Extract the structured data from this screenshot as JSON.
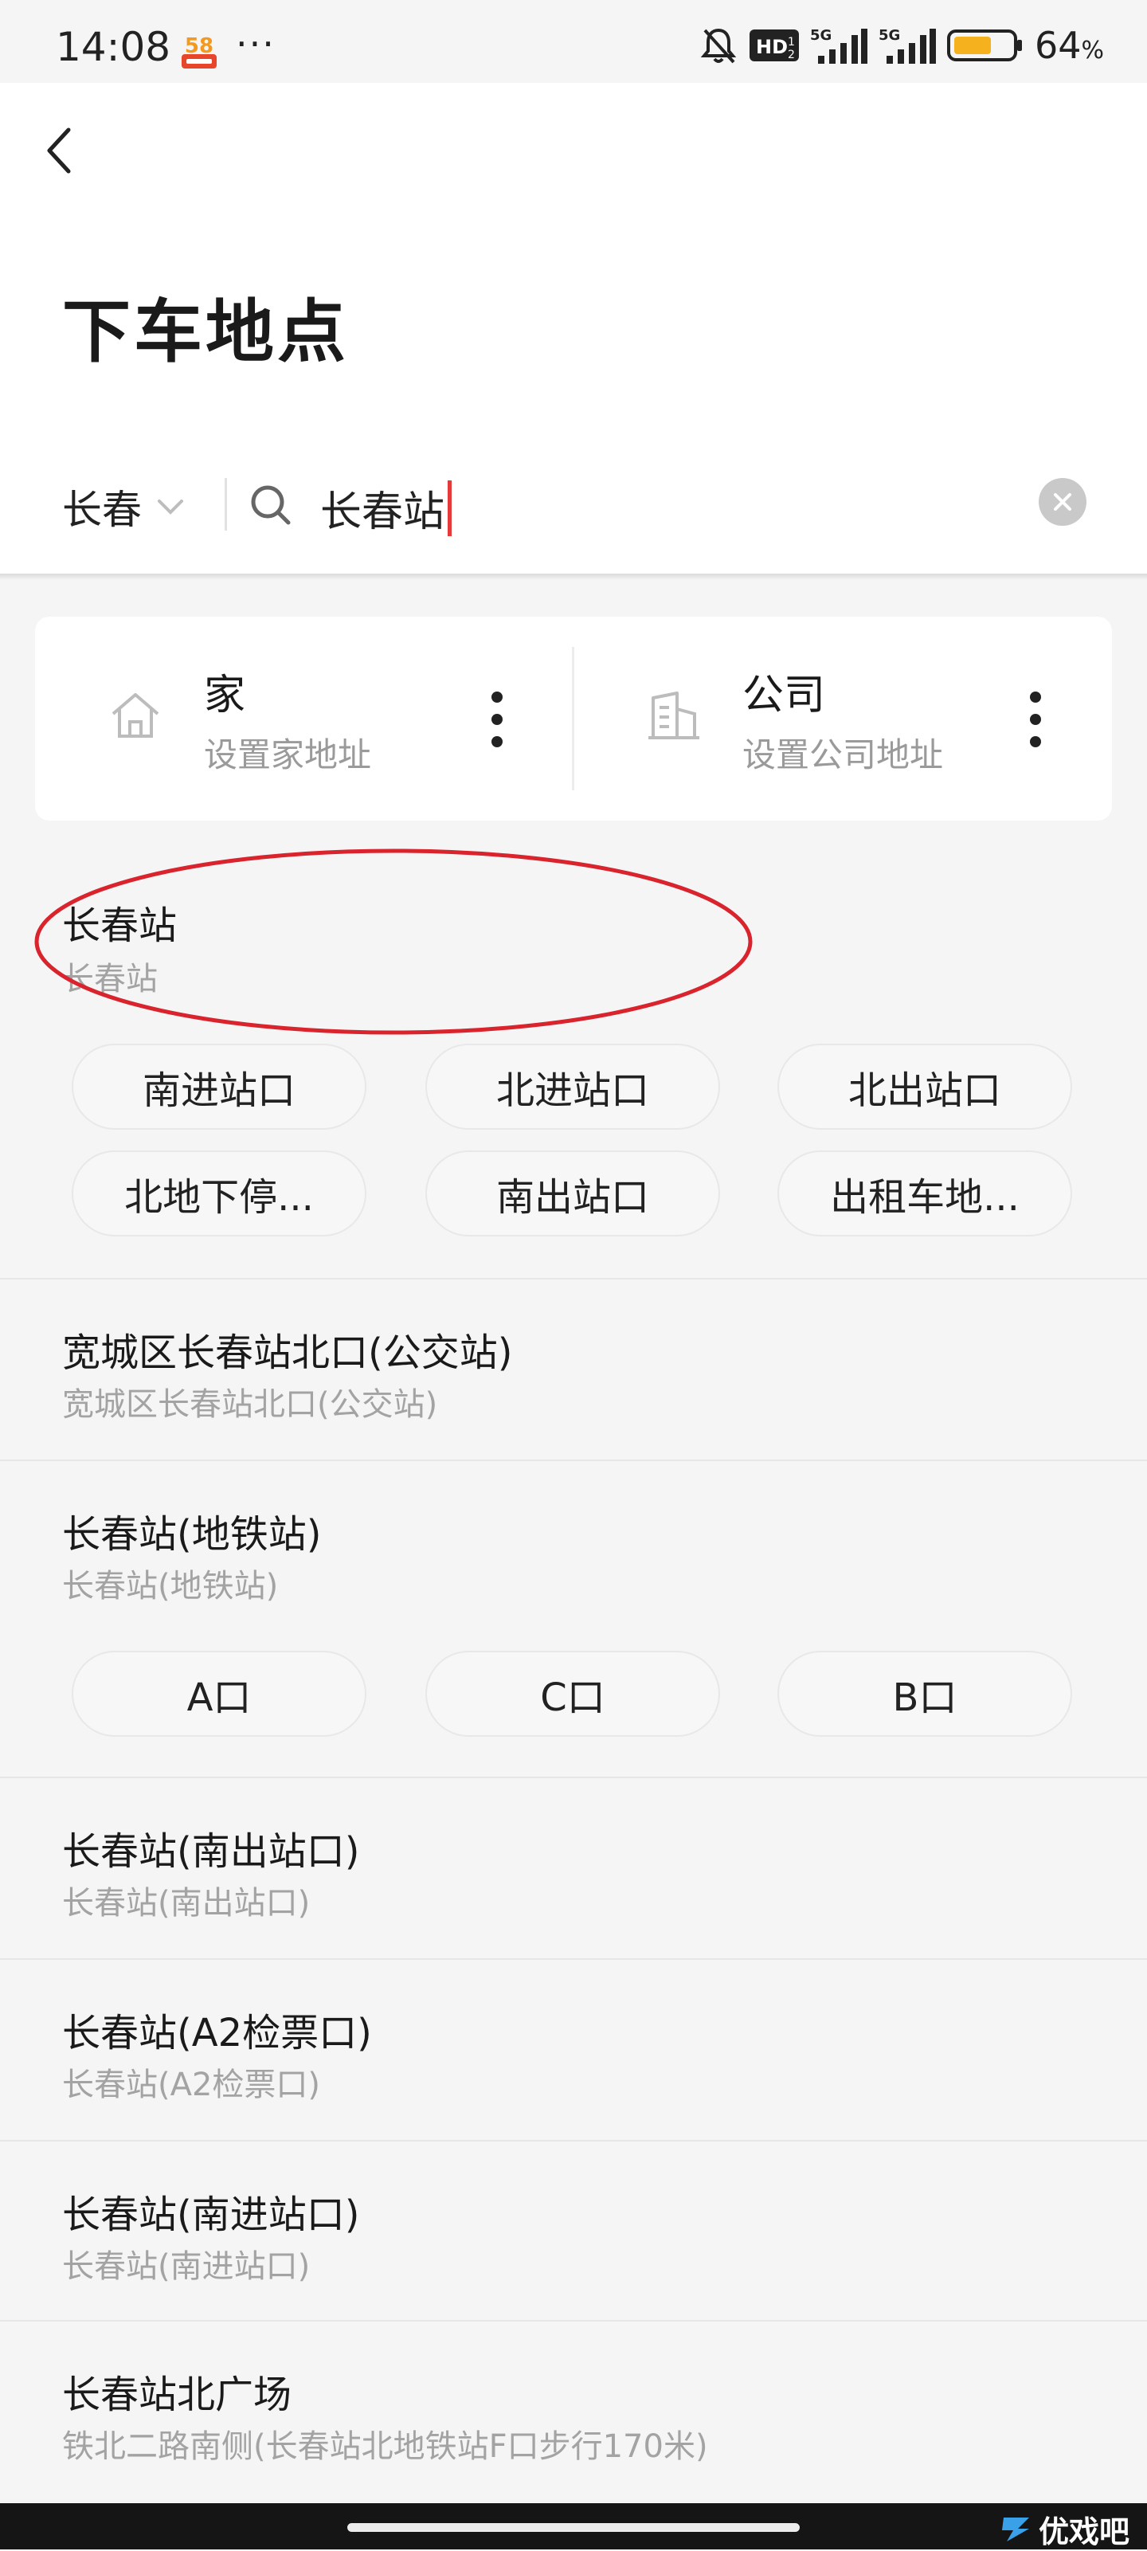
{
  "status_bar": {
    "time": "14:08",
    "app_badge": "58",
    "dots": "···",
    "battery_value": "64",
    "battery_unit": "%",
    "battery_level": 0.64,
    "net1": "5G",
    "net2": "5G",
    "hd": "HD"
  },
  "header": {
    "title": "下车地点",
    "city": "长春",
    "search_value": "长春站"
  },
  "quick": {
    "home_title": "家",
    "home_sub": "设置家地址",
    "company_title": "公司",
    "company_sub": "设置公司地址"
  },
  "results": [
    {
      "title": "长春站",
      "sub": "长春站",
      "chips": [
        "南进站口",
        "北进站口",
        "北出站口",
        "北地下停...",
        "南出站口",
        "出租车地..."
      ]
    },
    {
      "title": "宽城区长春站北口(公交站)",
      "sub": "宽城区长春站北口(公交站)"
    },
    {
      "title": "长春站(地铁站)",
      "sub": "长春站(地铁站)",
      "chips": [
        "A口",
        "C口",
        "B口"
      ]
    },
    {
      "title": "长春站(南出站口)",
      "sub": "长春站(南出站口)"
    },
    {
      "title": "长春站(A2检票口)",
      "sub": "长春站(A2检票口)"
    },
    {
      "title": "长春站(南进站口)",
      "sub": "长春站(南进站口)"
    },
    {
      "title": "长春站北广场",
      "sub": "铁北二路南侧(长春站北地铁站F口步行170米)"
    }
  ],
  "watermark": "优戏吧",
  "colors": {
    "caret": "#e53a3a",
    "annotation": "#d9232d",
    "battery": "#f5b21e"
  }
}
